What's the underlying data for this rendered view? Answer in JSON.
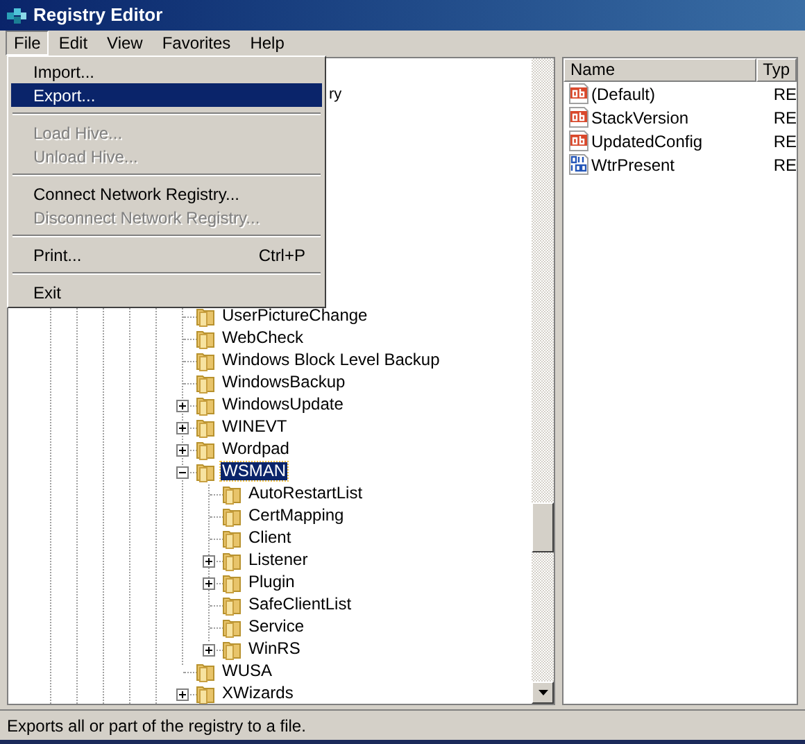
{
  "window": {
    "title": "Registry Editor"
  },
  "menu_bar": [
    {
      "label": "File",
      "open": true
    },
    {
      "label": "Edit",
      "open": false
    },
    {
      "label": "View",
      "open": false
    },
    {
      "label": "Favorites",
      "open": false
    },
    {
      "label": "Help",
      "open": false
    }
  ],
  "file_menu": [
    {
      "kind": "item",
      "label": "Import...",
      "disabled": false,
      "selected": false
    },
    {
      "kind": "item",
      "label": "Export...",
      "disabled": false,
      "selected": true
    },
    {
      "kind": "separator"
    },
    {
      "kind": "item",
      "label": "Load Hive...",
      "disabled": true,
      "selected": false
    },
    {
      "kind": "item",
      "label": "Unload Hive...",
      "disabled": true,
      "selected": false
    },
    {
      "kind": "separator"
    },
    {
      "kind": "item",
      "label": "Connect Network Registry...",
      "disabled": false,
      "selected": false
    },
    {
      "kind": "item",
      "label": "Disconnect Network Registry...",
      "disabled": true,
      "selected": false
    },
    {
      "kind": "separator"
    },
    {
      "kind": "item",
      "label": "Print...",
      "shortcut": "Ctrl+P",
      "disabled": false,
      "selected": false
    },
    {
      "kind": "separator"
    },
    {
      "kind": "item",
      "label": "Exit",
      "disabled": false,
      "selected": false
    }
  ],
  "tree_fragment": "ry",
  "tree": [
    {
      "label": "UserPictureChange",
      "has_children": false,
      "selected": false
    },
    {
      "label": "WebCheck",
      "has_children": false,
      "selected": false
    },
    {
      "label": "Windows Block Level Backup",
      "has_children": false,
      "selected": false
    },
    {
      "label": "WindowsBackup",
      "has_children": false,
      "selected": false
    },
    {
      "label": "WindowsUpdate",
      "has_children": true,
      "expanded": false,
      "selected": false
    },
    {
      "label": "WINEVT",
      "has_children": true,
      "expanded": false,
      "selected": false
    },
    {
      "label": "Wordpad",
      "has_children": true,
      "expanded": false,
      "selected": false
    },
    {
      "label": "WSMAN",
      "has_children": true,
      "expanded": true,
      "selected": true,
      "children": [
        {
          "label": "AutoRestartList",
          "has_children": false,
          "selected": false
        },
        {
          "label": "CertMapping",
          "has_children": false,
          "selected": false
        },
        {
          "label": "Client",
          "has_children": false,
          "selected": false
        },
        {
          "label": "Listener",
          "has_children": true,
          "expanded": false,
          "selected": false
        },
        {
          "label": "Plugin",
          "has_children": true,
          "expanded": false,
          "selected": false
        },
        {
          "label": "SafeClientList",
          "has_children": false,
          "selected": false
        },
        {
          "label": "Service",
          "has_children": false,
          "selected": false
        },
        {
          "label": "WinRS",
          "has_children": true,
          "expanded": false,
          "selected": false
        }
      ]
    },
    {
      "label": "WUSA",
      "has_children": false,
      "selected": false
    },
    {
      "label": "XWizards",
      "has_children": true,
      "expanded": false,
      "selected": false
    }
  ],
  "values": {
    "columns": [
      "Name",
      "Typ"
    ],
    "rows": [
      {
        "kind": "string",
        "name": "(Default)",
        "type": "RE"
      },
      {
        "kind": "string",
        "name": "StackVersion",
        "type": "RE"
      },
      {
        "kind": "string",
        "name": "UpdatedConfig",
        "type": "RE"
      },
      {
        "kind": "binary",
        "name": "WtrPresent",
        "type": "RE"
      }
    ]
  },
  "status_bar": "Exports all or part of the registry to a file."
}
